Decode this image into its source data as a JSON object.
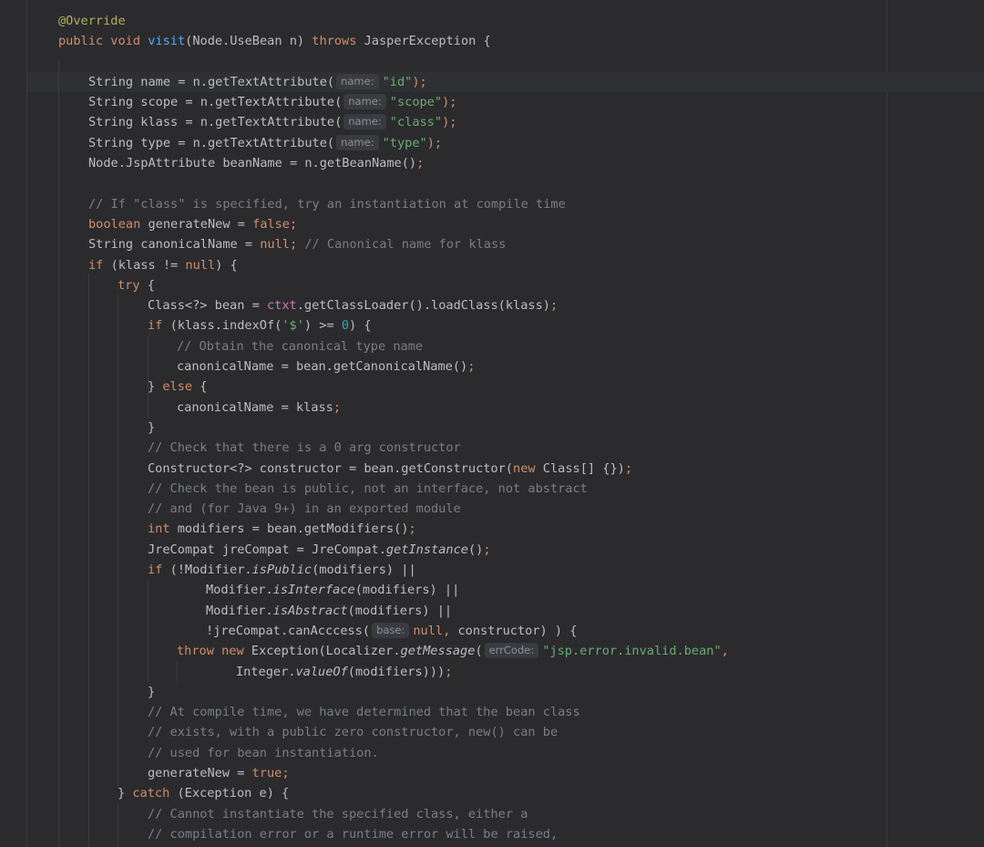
{
  "editor": {
    "lines": [
      {
        "indent": 64,
        "tokens": [
          {
            "t": "@Override",
            "c": "ann"
          }
        ]
      },
      {
        "indent": 64,
        "tokens": [
          {
            "t": "public void ",
            "c": "kw"
          },
          {
            "t": "visit",
            "c": "fn"
          },
          {
            "t": "(Node.UseBean n) "
          },
          {
            "t": "throws ",
            "c": "kw"
          },
          {
            "t": "JasperException {"
          }
        ]
      },
      {
        "indent": 64,
        "tokens": []
      },
      {
        "indent": 97,
        "tokens": [
          {
            "t": "String name = n.getTextAttribute("
          },
          {
            "t": "name:",
            "c": "hint"
          },
          {
            "t": "\"id\"",
            "c": "str"
          },
          {
            "t": ");",
            "c": "kw"
          }
        ]
      },
      {
        "indent": 97,
        "tokens": [
          {
            "t": "String scope = n.getTextAttribute("
          },
          {
            "t": "name:",
            "c": "hint"
          },
          {
            "t": "\"scope\"",
            "c": "str"
          },
          {
            "t": ");",
            "c": "kw"
          }
        ]
      },
      {
        "indent": 97,
        "tokens": [
          {
            "t": "String klass = n.getTextAttribute("
          },
          {
            "t": "name:",
            "c": "hint"
          },
          {
            "t": "\"class\"",
            "c": "str"
          },
          {
            "t": ");",
            "c": "kw"
          }
        ]
      },
      {
        "indent": 97,
        "tokens": [
          {
            "t": "String type = n.getTextAttribute("
          },
          {
            "t": "name:",
            "c": "hint"
          },
          {
            "t": "\"type\"",
            "c": "str"
          },
          {
            "t": ");",
            "c": "kw"
          }
        ]
      },
      {
        "indent": 97,
        "tokens": [
          {
            "t": "Node.JspAttribute beanName = n.getBeanName()"
          },
          {
            "t": ";",
            "c": "kw"
          }
        ]
      },
      {
        "indent": 97,
        "tokens": []
      },
      {
        "indent": 97,
        "tokens": [
          {
            "t": "// If \"class\" is specified, try an instantiation at compile time",
            "c": "cmt"
          }
        ]
      },
      {
        "indent": 97,
        "tokens": [
          {
            "t": "boolean ",
            "c": "kw"
          },
          {
            "t": "generateNew = "
          },
          {
            "t": "false;",
            "c": "kw"
          }
        ]
      },
      {
        "indent": 97,
        "tokens": [
          {
            "t": "String canonicalName = "
          },
          {
            "t": "null; ",
            "c": "kw"
          },
          {
            "t": "// Canonical name for klass",
            "c": "cmt"
          }
        ]
      },
      {
        "indent": 97,
        "tokens": [
          {
            "t": "if ",
            "c": "kw"
          },
          {
            "t": "(klass != "
          },
          {
            "t": "null",
            "c": "kw"
          },
          {
            "t": ") {"
          }
        ]
      },
      {
        "indent": 129,
        "tokens": [
          {
            "t": "try ",
            "c": "kw"
          },
          {
            "t": "{"
          }
        ]
      },
      {
        "indent": 162,
        "tokens": [
          {
            "t": "Class<?> bean = "
          },
          {
            "t": "ctxt",
            "c": "pur"
          },
          {
            "t": ".getClassLoader().loadClass(klass)"
          },
          {
            "t": ";",
            "c": "kw"
          }
        ]
      },
      {
        "indent": 162,
        "tokens": [
          {
            "t": "if ",
            "c": "kw"
          },
          {
            "t": "(klass.indexOf("
          },
          {
            "t": "'$'",
            "c": "str"
          },
          {
            "t": ") >= "
          },
          {
            "t": "0",
            "c": "num"
          },
          {
            "t": ") {"
          }
        ]
      },
      {
        "indent": 194,
        "tokens": [
          {
            "t": "// Obtain the canonical type name",
            "c": "cmt"
          }
        ]
      },
      {
        "indent": 194,
        "tokens": [
          {
            "t": "canonicalName = bean.getCanonicalName()"
          },
          {
            "t": ";",
            "c": "kw"
          }
        ]
      },
      {
        "indent": 162,
        "tokens": [
          {
            "t": "} "
          },
          {
            "t": "else ",
            "c": "kw"
          },
          {
            "t": "{"
          }
        ]
      },
      {
        "indent": 194,
        "tokens": [
          {
            "t": "canonicalName = klass"
          },
          {
            "t": ";",
            "c": "kw"
          }
        ]
      },
      {
        "indent": 162,
        "tokens": [
          {
            "t": "}"
          }
        ]
      },
      {
        "indent": 162,
        "tokens": [
          {
            "t": "// Check that there is a 0 arg constructor",
            "c": "cmt"
          }
        ]
      },
      {
        "indent": 162,
        "tokens": [
          {
            "t": "Constructor<?> constructor = bean.getConstructor("
          },
          {
            "t": "new ",
            "c": "kw"
          },
          {
            "t": "Class[] {})"
          },
          {
            "t": ";",
            "c": "kw"
          }
        ]
      },
      {
        "indent": 162,
        "tokens": [
          {
            "t": "// Check the bean is public, not an interface, not abstract",
            "c": "cmt"
          }
        ]
      },
      {
        "indent": 162,
        "tokens": [
          {
            "t": "// and (for Java 9+) in an exported module",
            "c": "cmt"
          }
        ]
      },
      {
        "indent": 162,
        "tokens": [
          {
            "t": "int ",
            "c": "kw"
          },
          {
            "t": "modifiers = bean.getModifiers()"
          },
          {
            "t": ";",
            "c": "kw"
          }
        ]
      },
      {
        "indent": 162,
        "tokens": [
          {
            "t": "JreCompat jreCompat = JreCompat."
          },
          {
            "t": "getInstance",
            "c": "it"
          },
          {
            "t": "()"
          },
          {
            "t": ";",
            "c": "kw"
          }
        ]
      },
      {
        "indent": 162,
        "tokens": [
          {
            "t": "if ",
            "c": "kw"
          },
          {
            "t": "(!Modifier."
          },
          {
            "t": "isPublic",
            "c": "it"
          },
          {
            "t": "(modifiers) ||"
          }
        ]
      },
      {
        "indent": 226,
        "tokens": [
          {
            "t": "Modifier."
          },
          {
            "t": "isInterface",
            "c": "it"
          },
          {
            "t": "(modifiers) ||"
          }
        ]
      },
      {
        "indent": 226,
        "tokens": [
          {
            "t": "Modifier."
          },
          {
            "t": "isAbstract",
            "c": "it"
          },
          {
            "t": "(modifiers) ||"
          }
        ]
      },
      {
        "indent": 226,
        "tokens": [
          {
            "t": "!jreCompat.canAcccess("
          },
          {
            "t": "base:",
            "c": "hint"
          },
          {
            "t": "null, ",
            "c": "kw"
          },
          {
            "t": "constructor) ) {"
          }
        ]
      },
      {
        "indent": 194,
        "tokens": [
          {
            "t": "throw new ",
            "c": "kw"
          },
          {
            "t": "Exception(Localizer."
          },
          {
            "t": "getMessage",
            "c": "it"
          },
          {
            "t": "("
          },
          {
            "t": "errCode:",
            "c": "hint"
          },
          {
            "t": "\"jsp.error.invalid.bean\"",
            "c": "str"
          },
          {
            "t": ",",
            "c": "kw"
          }
        ]
      },
      {
        "indent": 259,
        "tokens": [
          {
            "t": "Integer."
          },
          {
            "t": "valueOf",
            "c": "it"
          },
          {
            "t": "(modifiers)))"
          },
          {
            "t": ";",
            "c": "kw"
          }
        ]
      },
      {
        "indent": 162,
        "tokens": [
          {
            "t": "}"
          }
        ]
      },
      {
        "indent": 162,
        "tokens": [
          {
            "t": "// At compile time, we have determined that the bean class",
            "c": "cmt"
          }
        ]
      },
      {
        "indent": 162,
        "tokens": [
          {
            "t": "// exists, with a public zero constructor, new() can be",
            "c": "cmt"
          }
        ]
      },
      {
        "indent": 162,
        "tokens": [
          {
            "t": "// used for bean instantiation.",
            "c": "cmt"
          }
        ]
      },
      {
        "indent": 162,
        "tokens": [
          {
            "t": "generateNew = "
          },
          {
            "t": "true;",
            "c": "kw"
          }
        ]
      },
      {
        "indent": 129,
        "tokens": [
          {
            "t": "} "
          },
          {
            "t": "catch ",
            "c": "kw"
          },
          {
            "t": "(Exception e) {"
          }
        ]
      },
      {
        "indent": 162,
        "tokens": [
          {
            "t": "// Cannot instantiate the specified class, either a",
            "c": "cmt"
          }
        ]
      },
      {
        "indent": 162,
        "tokens": [
          {
            "t": "// compilation error or a runtime error will be raised,",
            "c": "cmt"
          }
        ]
      }
    ]
  }
}
